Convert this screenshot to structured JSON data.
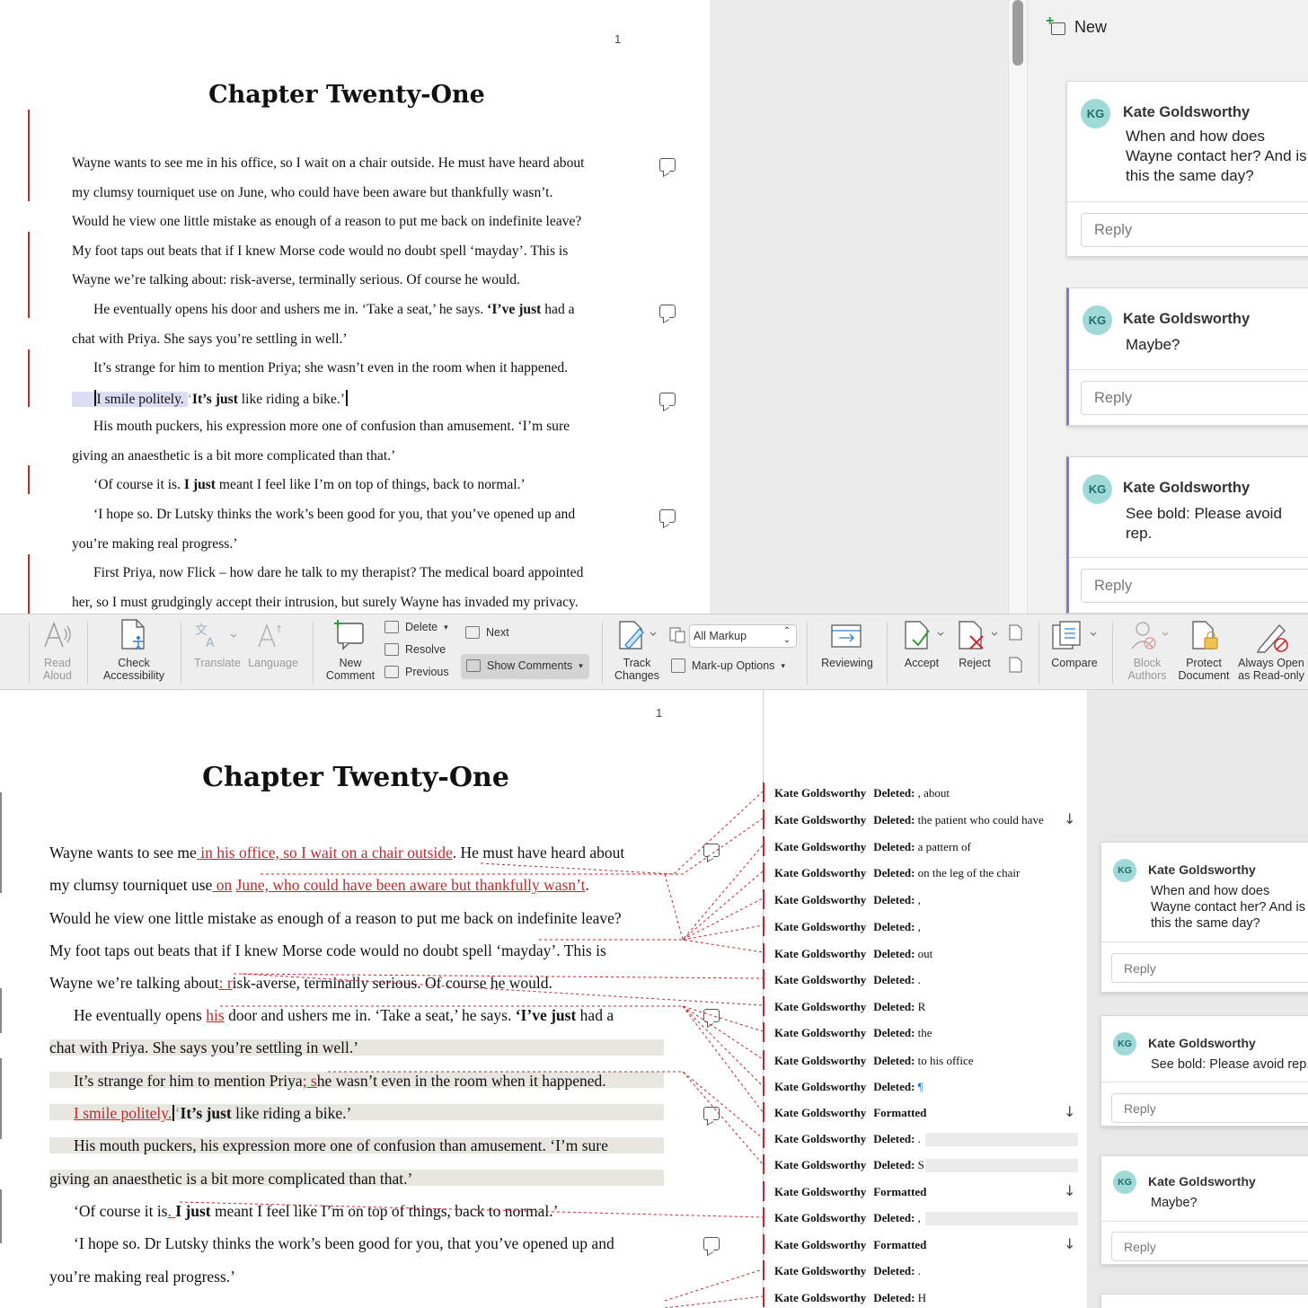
{
  "top": {
    "page_number": "1",
    "chapter_title": "Chapter Twenty-One",
    "lines": [
      "Wayne wants to see me in his office, so I wait on a chair outside. He must have heard about",
      "my clumsy tourniquet use on June, who could have been aware but thankfully wasn’t.",
      "Would he view one little mistake as enough of a reason to put me back on indefinite leave?",
      "My foot taps out beats that if I knew Morse code would no doubt spell ‘mayday’. This is",
      "Wayne we’re talking about: risk-averse, terminally serious. Of course he would.",
      "chat with Priya. She says you’re settling in well.’",
      "It’s strange for him to mention Priya; she wasn’t even in the room when it happened.",
      "His mouth puckers, his expression more one of confusion than amusement. ‘I’m sure",
      "giving an anaesthetic is a bit more complicated than that.’",
      "‘I hope so. Dr Lutsky thinks the work’s been good for you, that you’ve opened up and",
      "you’re making real progress.’",
      "First Priya, now Flick – how dare he talk to my therapist? The medical board appointed",
      "her, so I must grudgingly accept their intrusion, but surely Wayne has invaded my privacy."
    ],
    "line6": {
      "a": "He eventually opens his door and ushers me in. ‘Take a seat,’ he says. ",
      "b": "‘I’ve just",
      "c": " had a"
    },
    "line9": {
      "a": "I smile politely.",
      "b": "‘",
      "c": "It’s just",
      "d": " like riding a bike.’"
    },
    "line12": {
      "a": "‘Of course it is. ",
      "b": "I just",
      "c": " meant I feel like I’m on top of things, back to normal.’"
    },
    "new_label": "New",
    "comments": [
      {
        "initials": "KG",
        "author": "Kate Goldsworthy",
        "text": "When and how does Wayne contact her? And is this the same day?",
        "reply": "Reply"
      },
      {
        "initials": "KG",
        "author": "Kate Goldsworthy",
        "text": "Maybe?",
        "reply": "Reply"
      },
      {
        "initials": "KG",
        "author": "Kate Goldsworthy",
        "text": "See bold: Please avoid rep.",
        "reply": "Reply"
      }
    ]
  },
  "ribbon": {
    "read_aloud": [
      "Read",
      "Aloud"
    ],
    "check_accessibility": [
      "Check",
      "Accessibility"
    ],
    "translate": "Translate",
    "language": "Language",
    "new_comment": [
      "New",
      "Comment"
    ],
    "delete": "Delete",
    "resolve": "Resolve",
    "previous": "Previous",
    "next": "Next",
    "show_comments": "Show Comments",
    "track_changes": [
      "Track",
      "Changes"
    ],
    "markup_select": "All Markup",
    "markup_options": "Mark-up Options",
    "reviewing": "Reviewing",
    "accept": "Accept",
    "reject": "Reject",
    "compare": "Compare",
    "block_authors": [
      "Block",
      "Authors"
    ],
    "protect_document": [
      "Protect",
      "Document"
    ],
    "always_open": [
      "Always Open",
      "as Read-only"
    ]
  },
  "bottom": {
    "page_number": "1",
    "chapter_title": "Chapter Twenty-One",
    "l1": {
      "a": "Wayne wants to see me",
      "b": " in his office, so I wait on a chair outside",
      "c": ". He must have heard about"
    },
    "l2": {
      "a": "my clumsy tourniquet use",
      "b": " on",
      "c": " ",
      "d": "June, who could have been aware but thankfully wasn’t",
      "e": "."
    },
    "l3": "Would he view one little mistake as enough of a reason to put me back on indefinite leave?",
    "l4": "My foot taps out beats that if I knew Morse code would no doubt spell ‘mayday’. This is",
    "l5": {
      "a": "Wayne we’re talking about",
      "b": ": r",
      "c": "isk-averse, terminally serious. Of course he would."
    },
    "l6": {
      "a": "He eventually opens ",
      "b": "his",
      "c": " door and ushers me in. ‘Take a seat,’ he says. ",
      "d": "‘I’ve just",
      "e": " had a"
    },
    "l7": "chat with Priya. She says you’re settling in well.’",
    "l8": {
      "a": "It’s strange for him to mention Priya",
      "b": "; s",
      "c": "he wasn’t even in the room when it happened."
    },
    "l9": {
      "a": "I smile politely.",
      "b": "‘",
      "c": "It’s just",
      "d": " like riding a bike.’"
    },
    "l10": "His mouth puckers, his expression more one of confusion than amusement. ‘I’m sure",
    "l11": "giving an anaesthetic is a bit more complicated than that.’",
    "l12": {
      "a": "‘Of course it is",
      "b": ". ",
      "c": "I just",
      "d": " meant I feel like I’m on top of things, back to normal.’"
    },
    "l13": {
      "a": "‘I hope so. Dr Lutsky thinks the work’s been good for you, that you’ve opened up and"
    },
    "l14": "you’re making real progress.’",
    "revisions": [
      {
        "author": "Kate Goldsworthy",
        "kind": "Deleted:",
        "text": ", about"
      },
      {
        "author": "Kate Goldsworthy",
        "kind": "Deleted:",
        "text": "the patient who could have"
      },
      {
        "author": "Kate Goldsworthy",
        "kind": "Deleted:",
        "text": "a pattern of"
      },
      {
        "author": "Kate Goldsworthy",
        "kind": "Deleted:",
        "text": "on the leg of the chair"
      },
      {
        "author": "Kate Goldsworthy",
        "kind": "Deleted:",
        "text": ","
      },
      {
        "author": "Kate Goldsworthy",
        "kind": "Deleted:",
        "text": ","
      },
      {
        "author": "Kate Goldsworthy",
        "kind": "Deleted:",
        "text": " out"
      },
      {
        "author": "Kate Goldsworthy",
        "kind": "Deleted:",
        "text": "."
      },
      {
        "author": "Kate Goldsworthy",
        "kind": "Deleted:",
        "text": "R"
      },
      {
        "author": "Kate Goldsworthy",
        "kind": "Deleted:",
        "text": "the"
      },
      {
        "author": "Kate Goldsworthy",
        "kind": "Deleted:",
        "text": "to his office"
      },
      {
        "author": "Kate Goldsworthy",
        "kind": "Deleted:",
        "text": "¶"
      },
      {
        "author": "Kate Goldsworthy",
        "kind": "Formatted",
        "text": ""
      },
      {
        "author": "Kate Goldsworthy",
        "kind": "Deleted:",
        "text": "."
      },
      {
        "author": "Kate Goldsworthy",
        "kind": "Deleted:",
        "text": "S"
      },
      {
        "author": "Kate Goldsworthy",
        "kind": "Formatted",
        "text": ""
      },
      {
        "author": "Kate Goldsworthy",
        "kind": "Deleted:",
        "text": ","
      },
      {
        "author": "Kate Goldsworthy",
        "kind": "Formatted",
        "text": ""
      },
      {
        "author": "Kate Goldsworthy",
        "kind": "Deleted:",
        "text": "."
      },
      {
        "author": "Kate Goldsworthy",
        "kind": "Deleted:",
        "text": "H"
      }
    ],
    "comments": [
      {
        "initials": "KG",
        "author": "Kate Goldsworthy",
        "text": "When and how does Wayne contact her? And is this the same day?",
        "reply": "Reply"
      },
      {
        "initials": "KG",
        "author": "Kate Goldsworthy",
        "text": "See bold: Please avoid rep.",
        "reply": "Reply"
      },
      {
        "initials": "KG",
        "author": "Kate Goldsworthy",
        "text": "Maybe?",
        "reply": "Reply"
      }
    ]
  },
  "colors": {
    "insertion": "#c02a2a",
    "change_bar": "#d2232a",
    "avatar": "#9fd9d8",
    "active_comment": "#7a7ac8"
  },
  "icons": [
    "read-aloud-icon",
    "accessibility-icon",
    "translate-icon",
    "language-icon",
    "new-comment-icon",
    "delete-icon",
    "resolve-icon",
    "previous-icon",
    "next-icon",
    "show-comments-icon",
    "track-changes-icon",
    "markup-options-icon",
    "reviewing-icon",
    "accept-icon",
    "reject-icon",
    "compare-icon",
    "block-authors-icon",
    "protect-document-icon",
    "read-only-icon",
    "comment-icon",
    "new-comment-plus-icon"
  ]
}
